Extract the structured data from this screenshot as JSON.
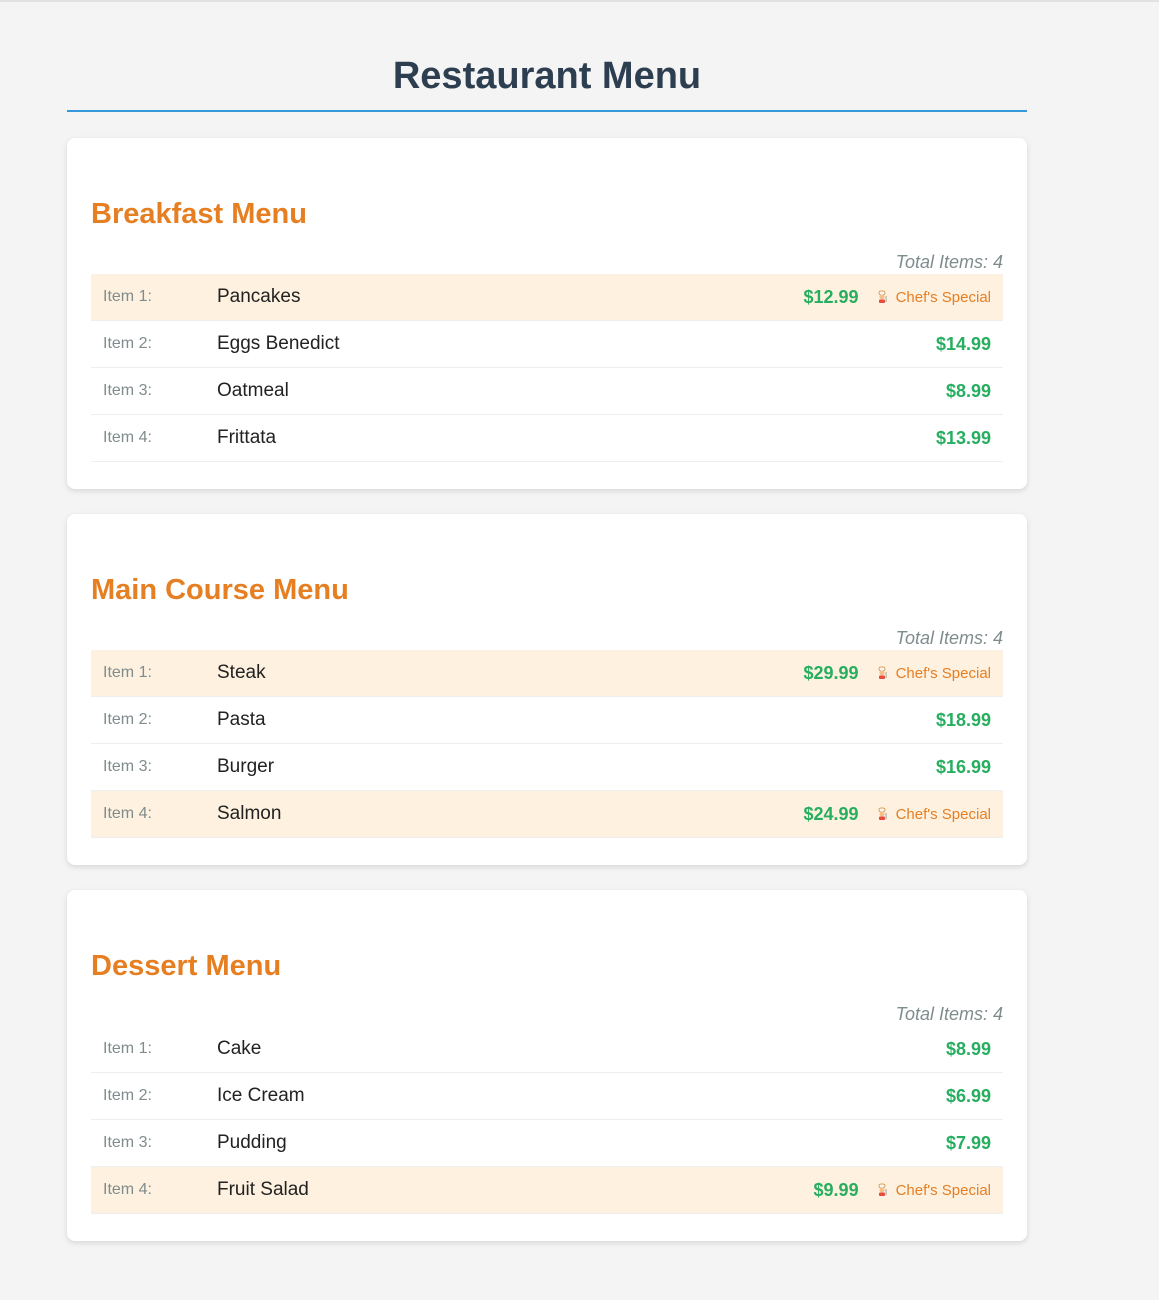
{
  "page": {
    "title": "Restaurant Menu"
  },
  "special_label": "Chef's Special",
  "colors": {
    "title": "#2c3e50",
    "accent": "#3498db",
    "heading": "#e67e22",
    "price": "#27ae60",
    "special_bg": "#fef1df"
  },
  "menus": [
    {
      "heading": "Breakfast Menu",
      "total": "Total Items: 4",
      "items": [
        {
          "index": "Item 1:",
          "name": "Pancakes",
          "price": "$12.99",
          "special": true
        },
        {
          "index": "Item 2:",
          "name": "Eggs Benedict",
          "price": "$14.99",
          "special": false
        },
        {
          "index": "Item 3:",
          "name": "Oatmeal",
          "price": "$8.99",
          "special": false
        },
        {
          "index": "Item 4:",
          "name": "Frittata",
          "price": "$13.99",
          "special": false
        }
      ]
    },
    {
      "heading": "Main Course Menu",
      "total": "Total Items: 4",
      "items": [
        {
          "index": "Item 1:",
          "name": "Steak",
          "price": "$29.99",
          "special": true
        },
        {
          "index": "Item 2:",
          "name": "Pasta",
          "price": "$18.99",
          "special": false
        },
        {
          "index": "Item 3:",
          "name": "Burger",
          "price": "$16.99",
          "special": false
        },
        {
          "index": "Item 4:",
          "name": "Salmon",
          "price": "$24.99",
          "special": true
        }
      ]
    },
    {
      "heading": "Dessert Menu",
      "total": "Total Items: 4",
      "items": [
        {
          "index": "Item 1:",
          "name": "Cake",
          "price": "$8.99",
          "special": false
        },
        {
          "index": "Item 2:",
          "name": "Ice Cream",
          "price": "$6.99",
          "special": false
        },
        {
          "index": "Item 3:",
          "name": "Pudding",
          "price": "$7.99",
          "special": false
        },
        {
          "index": "Item 4:",
          "name": "Fruit Salad",
          "price": "$9.99",
          "special": true
        }
      ]
    }
  ]
}
